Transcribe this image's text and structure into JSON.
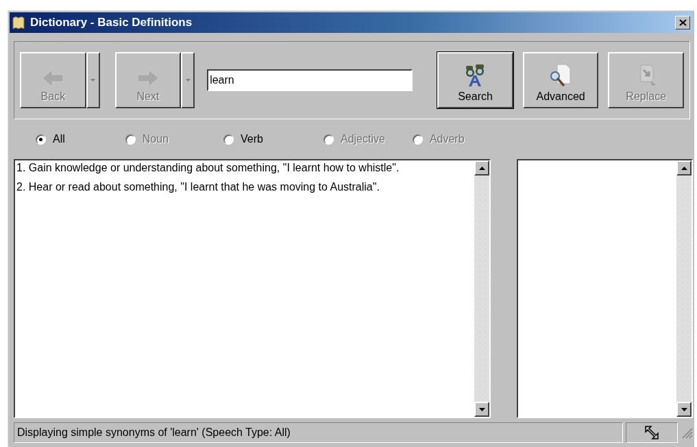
{
  "window": {
    "title": "Dictionary - Basic Definitions"
  },
  "toolbar": {
    "nav_buttons": [
      {
        "label": "Back",
        "kind": "back",
        "disabled": true
      },
      {
        "label": "Next",
        "kind": "next",
        "disabled": true
      }
    ],
    "search_field": {
      "value": "learn"
    },
    "buttons": [
      {
        "label": "Search",
        "kind": "search",
        "disabled": false,
        "default": true
      },
      {
        "label": "Advanced",
        "kind": "advanced",
        "disabled": false,
        "default": false
      },
      {
        "label": "Replace",
        "kind": "replace",
        "disabled": true,
        "default": false
      }
    ]
  },
  "speech_types": [
    {
      "label": "All",
      "selected": true,
      "disabled": false
    },
    {
      "label": "Noun",
      "selected": false,
      "disabled": true
    },
    {
      "label": "Verb",
      "selected": false,
      "disabled": false
    },
    {
      "label": "Adjective",
      "selected": false,
      "disabled": true
    },
    {
      "label": "Adverb",
      "selected": false,
      "disabled": true
    }
  ],
  "definitions": [
    "1. Gain knowledge or understanding about something, \"I learnt how to whistle\".",
    "2. Hear or read about something, \"I learnt that he was moving to Australia\"."
  ],
  "status_bar": {
    "text": "Displaying simple synonyms of 'learn' (Speech Type: All)"
  }
}
